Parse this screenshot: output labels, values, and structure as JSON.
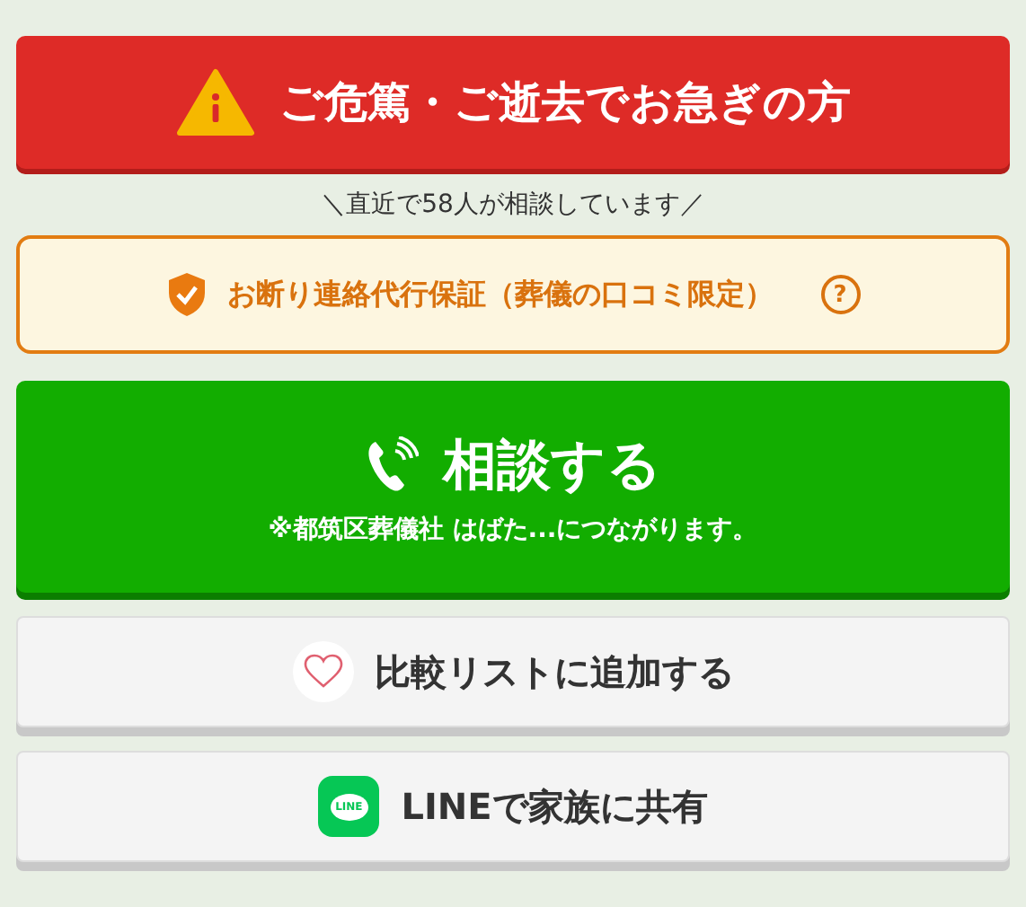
{
  "urgent_button": {
    "label": "ご危篤・ご逝去でお急ぎの方"
  },
  "consult_count": "＼直近で58人が相談しています／",
  "guarantee": {
    "label": "お断り連絡代行保証（葬儀の口コミ限定）",
    "help": "?"
  },
  "call_button": {
    "label": "相談する",
    "note": "※都筑区葬儀社 はばた...につながります。"
  },
  "secondary_buttons": [
    {
      "kind": "favorite",
      "label": "比較リストに追加する"
    },
    {
      "kind": "share",
      "label": "LINEで家族に共有",
      "icon_text": "LINE"
    }
  ]
}
